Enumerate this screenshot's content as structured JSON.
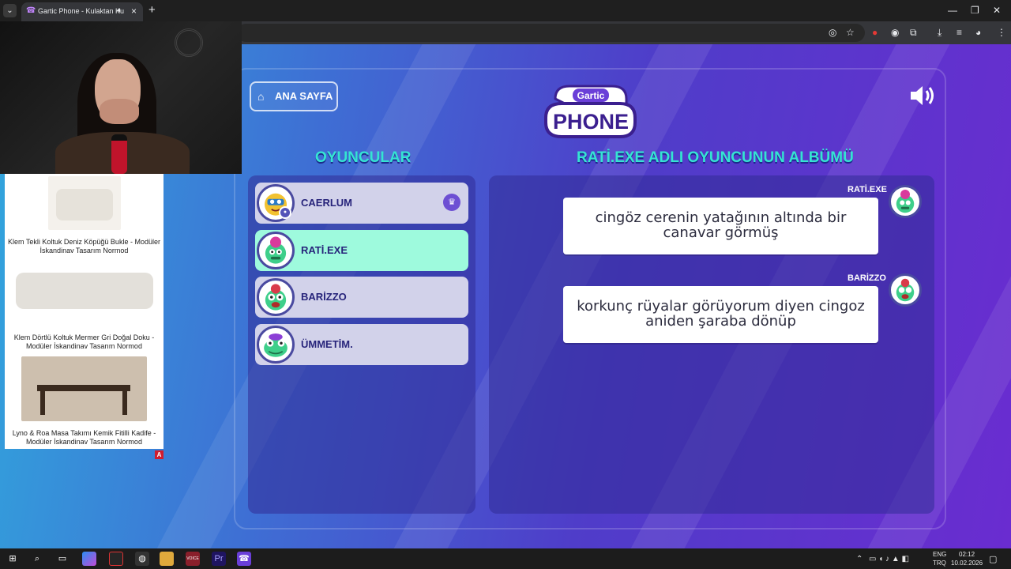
{
  "browser": {
    "tab_title": "Gartic Phone - Kulaktan Ku",
    "tab_favicon": "☎",
    "new_tab_icon": "+",
    "tab_menu_icon": "⌄"
  },
  "game": {
    "home_label": "ANA SAYFA",
    "logo_top": "Gartic",
    "logo_bottom": "PHONE",
    "players_heading": "OYUNCULAR",
    "album_heading": "RATİ.EXE ADLI OYUNCUNUN ALBÜMÜ",
    "players": [
      {
        "name": "CAERLUM",
        "host": true,
        "you": true,
        "avatar_color": "#f2c230"
      },
      {
        "name": "RATİ.EXE",
        "active": true,
        "avatar_color": "#3ecf8a"
      },
      {
        "name": "BARİZZO",
        "avatar_color": "#3ecf8a"
      },
      {
        "name": "ÜMMETİM.",
        "avatar_color": "#3ecf8a"
      }
    ],
    "album": [
      {
        "author": "RATİ.EXE",
        "text": "cingöz cerenin yatağının altında bir canavar görmüş"
      },
      {
        "author": "BARİZZO",
        "text": "korkunç rüyalar görüyorum diyen cingoz aniden şaraba dönüp"
      }
    ]
  },
  "ad": {
    "items": [
      {
        "caption": "Klem Tekli Koltuk Deniz Köpüğü Bukle - Modüler İskandinav Tasarım Normod"
      },
      {
        "caption": "Klem Dörtlü Koltuk Mermer Gri Doğal Doku - Modüler İskandinav Tasarım Normod"
      },
      {
        "caption": "Lyno & Roa Masa Takımı Kemik Fitilli Kadife - Modüler İskandinav Tasarım Normod"
      }
    ],
    "badge": "A"
  },
  "taskbar": {
    "lang_top": "ENG",
    "lang_bottom": "TRQ",
    "time": "02:12",
    "date": "10.02.2026"
  }
}
